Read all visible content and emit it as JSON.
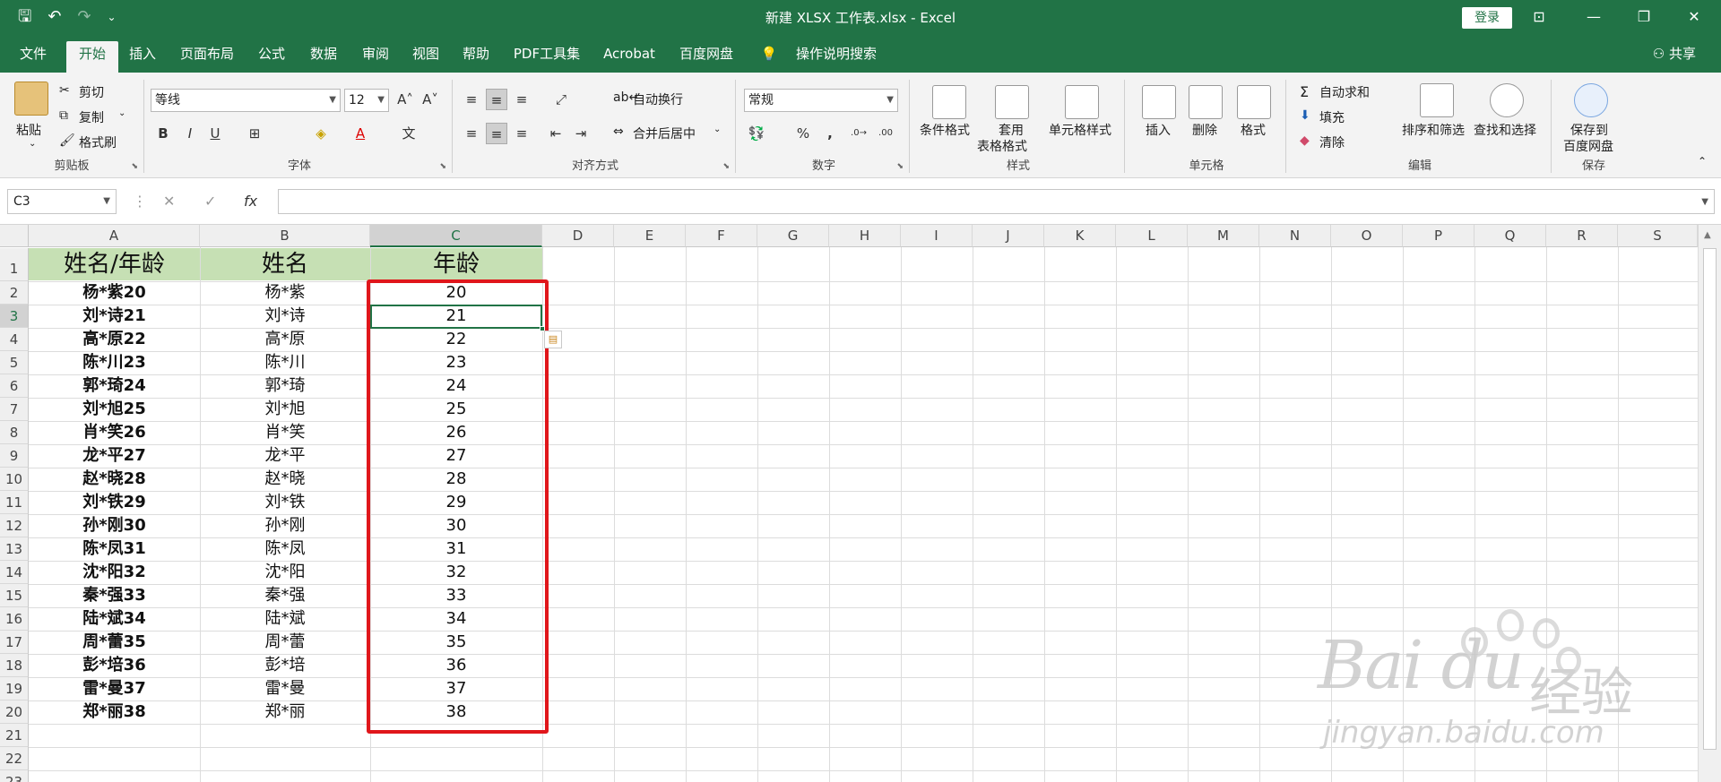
{
  "titlebar": {
    "title": "新建 XLSX 工作表.xlsx  -  Excel",
    "login": "登录",
    "minimize": "—",
    "maximize": "❐",
    "close": "✕"
  },
  "tabs": [
    "文件",
    "开始",
    "插入",
    "页面布局",
    "公式",
    "数据",
    "审阅",
    "视图",
    "帮助",
    "PDF工具集",
    "Acrobat",
    "百度网盘"
  ],
  "active_tab": "开始",
  "tell_me": "操作说明搜索",
  "share": "共享",
  "ribbon": {
    "clipboard": {
      "label": "剪贴板",
      "paste": "粘贴",
      "cut": "剪切",
      "copy": "复制",
      "format_painter": "格式刷"
    },
    "font": {
      "label": "字体",
      "font_name": "等线",
      "font_size": "12",
      "bold": "B",
      "italic": "I",
      "underline": "U",
      "wen": "文"
    },
    "alignment": {
      "label": "对齐方式",
      "wrap": "自动换行",
      "merge": "合并后居中"
    },
    "number": {
      "label": "数字",
      "format": "常规",
      "percent": "%",
      "comma": ","
    },
    "styles": {
      "label": "样式",
      "conditional": "条件格式",
      "table_1": "套用",
      "table_2": "表格格式",
      "cell_styles": "单元格样式"
    },
    "cells": {
      "label": "单元格",
      "insert": "插入",
      "delete": "删除",
      "format": "格式"
    },
    "editing": {
      "label": "编辑",
      "autosum": "自动求和",
      "fill": "填充",
      "clear": "清除",
      "sort": "排序和筛选",
      "find": "查找和选择"
    },
    "save": {
      "label": "保存",
      "line1": "保存到",
      "line2": "百度网盘"
    }
  },
  "formula_bar": {
    "name_box": "C3",
    "fx": "fx",
    "value": ""
  },
  "columns": [
    "A",
    "B",
    "C",
    "D",
    "E",
    "F",
    "G",
    "H",
    "I",
    "J",
    "K",
    "L",
    "M",
    "N",
    "O",
    "P",
    "Q",
    "R",
    "S"
  ],
  "selected_column": "C",
  "selected_row": 3,
  "row_numbers": [
    "1",
    "2",
    "3",
    "4",
    "5",
    "6",
    "7",
    "8",
    "9",
    "10",
    "11",
    "12",
    "13",
    "14",
    "15",
    "16",
    "17",
    "18",
    "19",
    "20",
    "21",
    "22",
    "23"
  ],
  "header": {
    "a": "姓名/年龄",
    "b": "姓名",
    "c": "年龄"
  },
  "rows": [
    {
      "a": "杨*紫20",
      "b": "杨*紫",
      "c": "20"
    },
    {
      "a": "刘*诗21",
      "b": "刘*诗",
      "c": "21"
    },
    {
      "a": "高*原22",
      "b": "高*原",
      "c": "22"
    },
    {
      "a": "陈*川23",
      "b": "陈*川",
      "c": "23"
    },
    {
      "a": "郭*琦24",
      "b": "郭*琦",
      "c": "24"
    },
    {
      "a": "刘*旭25",
      "b": "刘*旭",
      "c": "25"
    },
    {
      "a": "肖*笑26",
      "b": "肖*笑",
      "c": "26"
    },
    {
      "a": "龙*平27",
      "b": "龙*平",
      "c": "27"
    },
    {
      "a": "赵*晓28",
      "b": "赵*晓",
      "c": "28"
    },
    {
      "a": "刘*铁29",
      "b": "刘*铁",
      "c": "29"
    },
    {
      "a": "孙*刚30",
      "b": "孙*刚",
      "c": "30"
    },
    {
      "a": "陈*凤31",
      "b": "陈*凤",
      "c": "31"
    },
    {
      "a": "沈*阳32",
      "b": "沈*阳",
      "c": "32"
    },
    {
      "a": "秦*强33",
      "b": "秦*强",
      "c": "33"
    },
    {
      "a": "陆*斌34",
      "b": "陆*斌",
      "c": "34"
    },
    {
      "a": "周*蕾35",
      "b": "周*蕾",
      "c": "35"
    },
    {
      "a": "彭*培36",
      "b": "彭*培",
      "c": "36"
    },
    {
      "a": "雷*曼37",
      "b": "雷*曼",
      "c": "37"
    },
    {
      "a": "郑*丽38",
      "b": "郑*丽",
      "c": "38"
    }
  ],
  "watermark": {
    "brand": "Bai du",
    "cn": "经验",
    "url": "jingyan.baidu.com"
  },
  "colors": {
    "accent": "#217346",
    "header_fill": "#c6e0b4",
    "highlight": "#e0161b"
  }
}
